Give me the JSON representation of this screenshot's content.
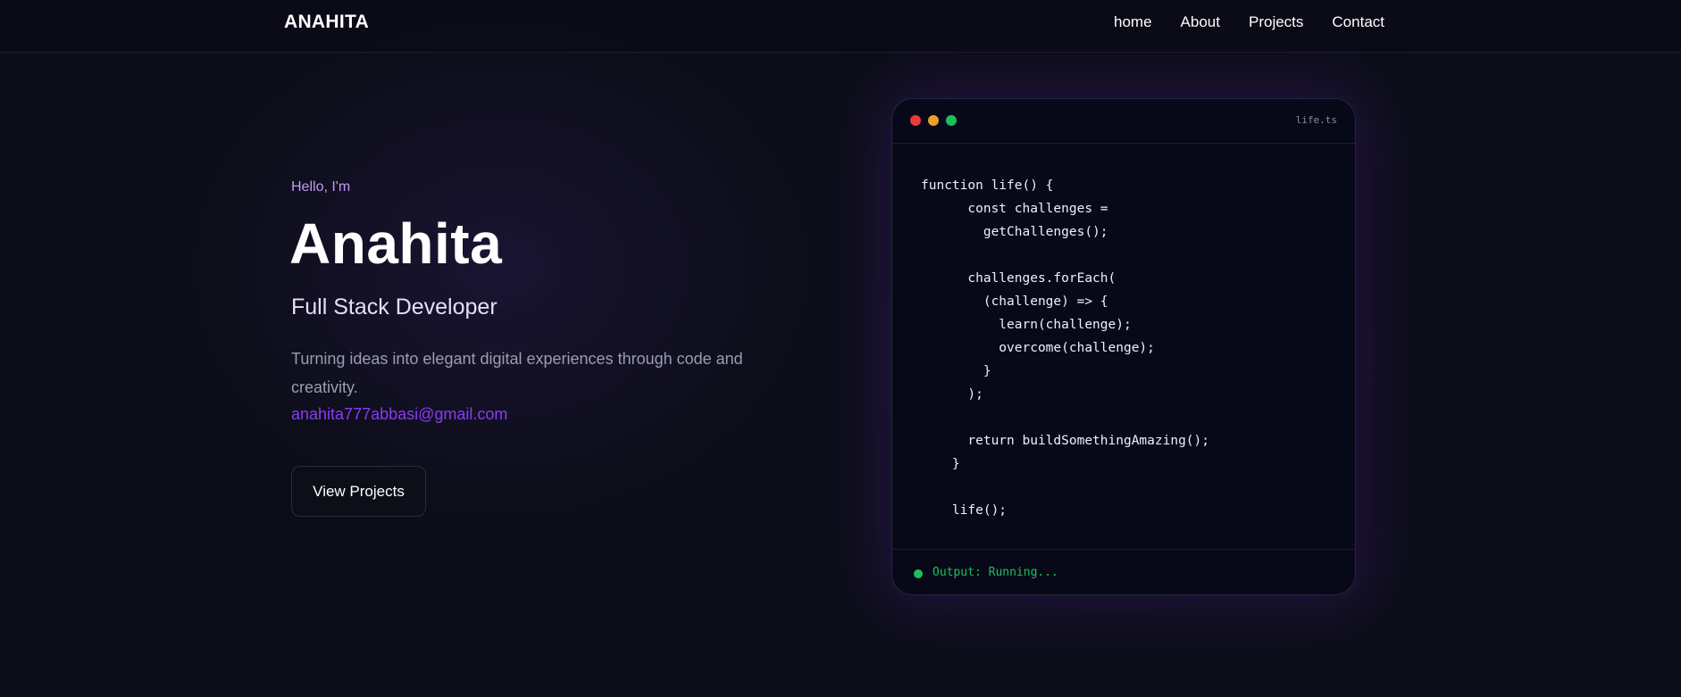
{
  "colors": {
    "background": "#0b0d17",
    "accent_purple": "#8a3cf0",
    "greeting_purple": "#c29af2",
    "status_green": "#1dbf5b",
    "dot_red": "#ea3b3b",
    "dot_yellow": "#eaa12a",
    "dot_green": "#1dbf5b"
  },
  "nav": {
    "brand": "ANAHITA",
    "links": [
      "home",
      "About",
      "Projects",
      "Contact"
    ]
  },
  "hero": {
    "greeting": "Hello, I'm",
    "name": "Anahita",
    "role": "Full Stack Developer",
    "description": "Turning ideas into elegant digital experiences through code and creativity.",
    "email": "anahita777abbasi@gmail.com",
    "cta_label": "View Projects"
  },
  "code_window": {
    "file_name": "life.ts",
    "lines": [
      "function life() {",
      "      const challenges =",
      "        getChallenges();",
      "",
      "      challenges.forEach(",
      "        (challenge) => {",
      "          learn(challenge);",
      "          overcome(challenge);",
      "        }",
      "      );",
      "",
      "      return buildSomethingAmazing();",
      "    }",
      "",
      "    life();"
    ],
    "status": "Output: Running..."
  }
}
